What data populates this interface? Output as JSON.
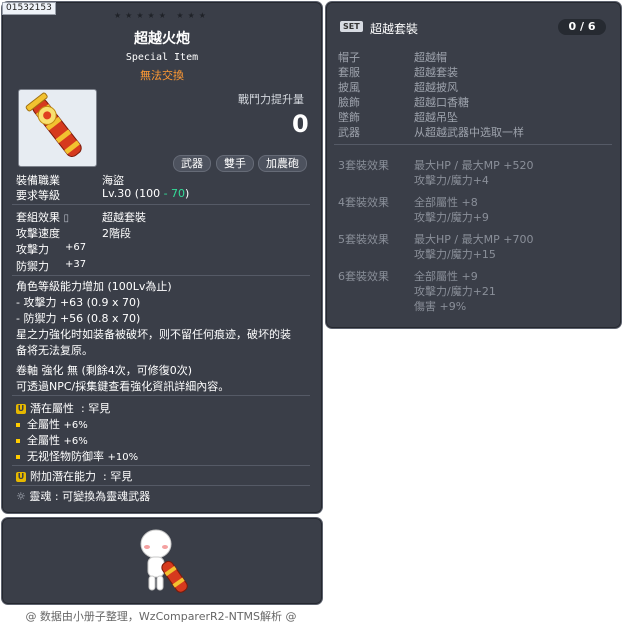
{
  "item": {
    "code": "01532153",
    "stars": "★★★★★  ★★★",
    "name": "超越火炮",
    "subtitle": "Special Item",
    "trade": "無法交換",
    "power_label": "戰鬥力提升量",
    "power_value": "0",
    "tags": [
      "武器",
      "雙手",
      "加農砲"
    ],
    "job_label": "裝備職業",
    "job_value": "海盜",
    "req_label": "要求等級",
    "req_value_prefix": "Lv.30 (100 ",
    "req_value_bonus": "- 70",
    "req_value_suffix": ")",
    "set_label": "套組效果",
    "set_value": "超越套裝",
    "speed_label": "攻擊速度",
    "speed_value": "2階段",
    "atk_label": "攻擊力",
    "atk_value": "+67",
    "def_label": "防禦力",
    "def_value": "+37",
    "scaling_header": "角色等級能力增加 (100Lv為止)",
    "scaling_atk": "- 攻擊力 +63 (0.9 x 70)",
    "scaling_def": "- 防禦力 +56 (0.8 x 70)",
    "star_desc_1": "星之力強化时如装备被破坏，则不留任何痕迹，破坏的装",
    "star_desc_2": "备将无法复原。",
    "scroll_line": "卷軸 強化 無 (剩餘4次，可修復0次)",
    "npc_line": "可透過NPC/採集鍵查看強化資訊詳細內容。",
    "pot_label": "潛在屬性",
    "pot_grade": ": 罕見",
    "pot_lines": [
      {
        "name": "全屬性",
        "val": "+6%"
      },
      {
        "name": "全屬性",
        "val": "+6%"
      },
      {
        "name": "无视怪物防御率",
        "val": "+10%"
      }
    ],
    "add_pot_label": "附加潛在能力",
    "add_pot_grade": ": 罕見",
    "soul_line": "靈魂 : 可變換為靈魂武器"
  },
  "set": {
    "badge": "SET",
    "title": "超越套裝",
    "count": "0 / 6",
    "parts": [
      {
        "slot": "帽子",
        "name": "超越帽"
      },
      {
        "slot": "套服",
        "name": "超越套装"
      },
      {
        "slot": "披風",
        "name": "超越披风"
      },
      {
        "slot": "臉飾",
        "name": "超越口香糖"
      },
      {
        "slot": "墜飾",
        "name": "超越吊坠"
      },
      {
        "slot": "武器",
        "name": "从超越武器中选取一样"
      }
    ],
    "effects": [
      {
        "label": "3套裝效果",
        "lines": [
          "最大HP / 最大MP  +520",
          "攻擊力/魔力+4"
        ]
      },
      {
        "label": "4套裝效果",
        "lines": [
          "全部屬性  +8",
          "攻擊力/魔力+9"
        ]
      },
      {
        "label": "5套裝效果",
        "lines": [
          "最大HP / 最大MP  +700",
          "攻擊力/魔力+15"
        ]
      },
      {
        "label": "6套裝效果",
        "lines": [
          "全部屬性  +9",
          "攻擊力/魔力+21",
          "傷害  +9%"
        ]
      }
    ]
  },
  "footer": "@ 数据由小册子整理，WzComparerR2-NTMS解析 @"
}
